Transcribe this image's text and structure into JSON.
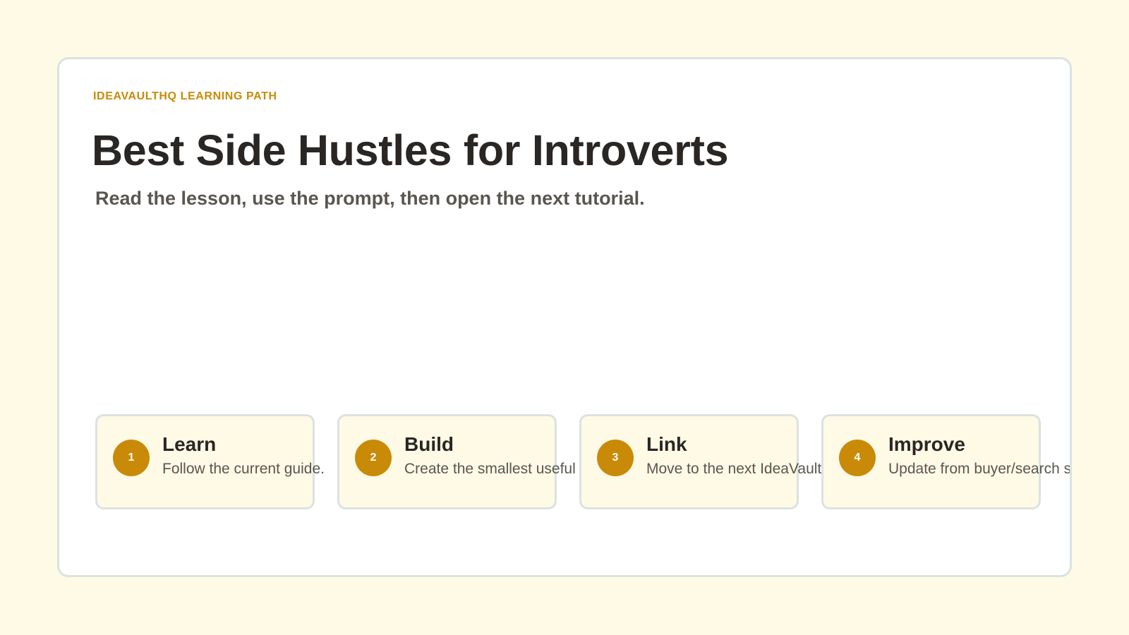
{
  "eyebrow": "IDEAVAULTHQ LEARNING PATH",
  "title": "Best Side Hustles for Introverts",
  "subtitle": "Read the lesson, use the prompt, then open the next tutorial.",
  "steps": [
    {
      "number": "1",
      "title": "Learn",
      "description": "Follow the current guide."
    },
    {
      "number": "2",
      "title": "Build",
      "description": "Create the smallest useful"
    },
    {
      "number": "3",
      "title": "Link",
      "description": "Move to the next IdeaVault"
    },
    {
      "number": "4",
      "title": "Improve",
      "description": "Update from buyer/search signals"
    }
  ],
  "colors": {
    "background": "#fefae6",
    "accent": "#c98a08",
    "heading": "#2a2623",
    "body_text": "#5a5650",
    "border": "#dae3e0"
  }
}
